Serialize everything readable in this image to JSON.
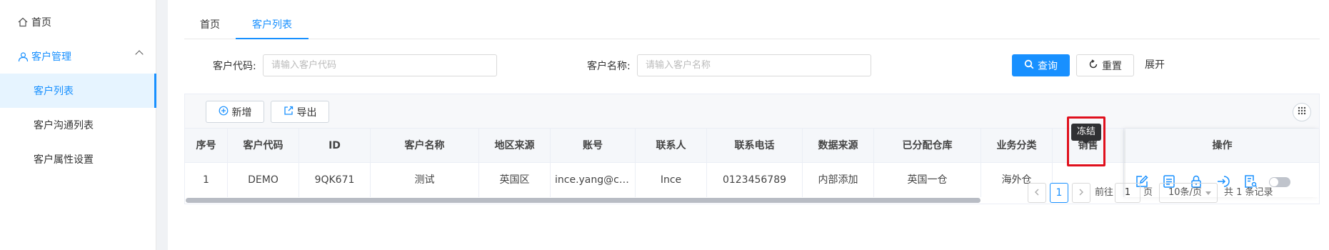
{
  "sidebar": {
    "home_label": "首页",
    "group_label": "客户管理",
    "items": [
      {
        "label": "客户列表",
        "active": true
      },
      {
        "label": "客户沟通列表",
        "active": false
      },
      {
        "label": "客户属性设置",
        "active": false
      }
    ]
  },
  "tabs": [
    {
      "label": "首页",
      "active": false
    },
    {
      "label": "客户列表",
      "active": true
    }
  ],
  "search": {
    "code_label": "客户代码:",
    "code_placeholder": "请输入客户代码",
    "name_label": "客户名称:",
    "name_placeholder": "请输入客户名称",
    "query_label": "查询",
    "reset_label": "重置",
    "expand_label": "展开"
  },
  "toolbar": {
    "add_label": "新增",
    "export_label": "导出"
  },
  "table": {
    "columns": [
      "序号",
      "客户代码",
      "ID",
      "客户名称",
      "地区来源",
      "账号",
      "联系人",
      "联系电话",
      "数据来源",
      "已分配仓库",
      "业务分类",
      "销售"
    ],
    "ops_header": "操作",
    "rows": [
      [
        "1",
        "DEMO",
        "9QK671",
        "测试",
        "英国区",
        "ince.yang@ca...",
        "Ince",
        "0123456789",
        "内部添加",
        "英国一仓",
        "海外仓",
        ""
      ]
    ]
  },
  "tooltip": {
    "text": "冻结"
  },
  "pagination": {
    "current_page": "1",
    "goto_label": "前往",
    "goto_value": "1",
    "page_label": "页",
    "page_size": "10条/页",
    "total_label": "共 1 条记录"
  },
  "colors": {
    "accent": "#1890ff",
    "highlight": "#e0101d"
  }
}
